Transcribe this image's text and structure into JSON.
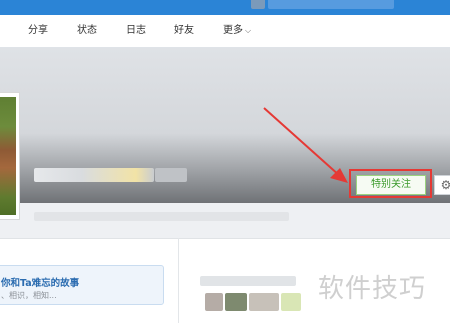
{
  "nav": {
    "items": [
      "分享",
      "状态",
      "日志",
      "好友"
    ],
    "more": "更多"
  },
  "profile": {
    "follow_label": "特别关注",
    "settings_icon": "⚙"
  },
  "story": {
    "title": "你和Ta难忘的故事",
    "subtitle": "、相识，相知..."
  },
  "watermark": "软件技巧",
  "colors": {
    "topbar": "#2b84d6",
    "annotation": "#e53935",
    "follow_text": "#3a9a2a",
    "follow_border": "#9bd37e"
  }
}
